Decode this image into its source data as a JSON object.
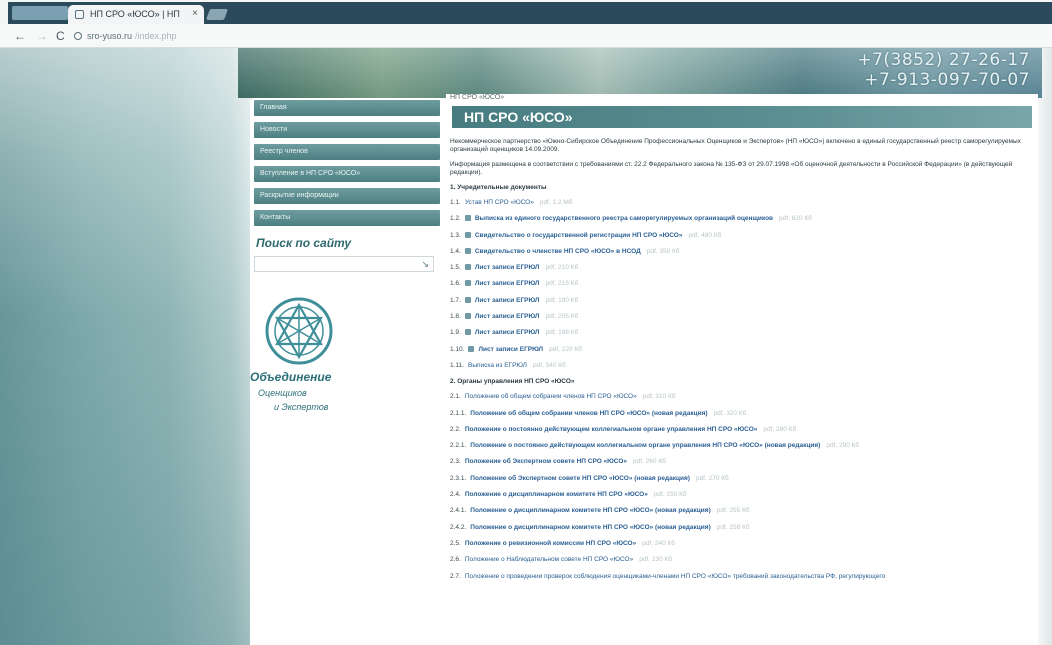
{
  "browser": {
    "tab_title": "НП СРО «ЮСО» | НП",
    "tab_close": "×",
    "url_domain": "sro-yuso.ru",
    "url_rest": "/index.php",
    "back": "←",
    "forward": "→",
    "reload": "C"
  },
  "header": {
    "phone1": "+7(3852) 27-26-17",
    "phone2": "+7-913-097-70-07"
  },
  "sidebar": {
    "menu": [
      "Главная",
      "Новости",
      "Реестр членов",
      "Вступление в НП СРО «ЮСО»",
      "Раскрытие информации",
      "Контакты"
    ],
    "search_title": "Поиск по сайту",
    "search_icon": "search-icon",
    "brand_name": "Объединение",
    "brand_line1": "Оценщиков",
    "brand_line2": "и Экспертов"
  },
  "main": {
    "breadcrumb": "НП СРО «ЮСО»",
    "title": "НП СРО «ЮСО»",
    "paragraphs": [
      "Некоммерческое партнерство «Южно-Сибирское Объединение Профессиональных Оценщиков и Экспертов» (НП «ЮСО») включено в единый государственный реестр саморегулируемых организаций оценщиков 14.09.2009.",
      "Информация размещена в соответствии с требованиями ст. 22.2 Федерального закона № 135-ФЗ от 29.07.1998 «Об оценочной деятельности в Российской Федерации» (в действующей редакции)."
    ],
    "section1_title": "1. Учредительные документы",
    "section1_docs": [
      {
        "num": "1.1.",
        "text": "Устав НП СРО «ЮСО»",
        "meta": "pdf, 1.2 Мб",
        "icon": false,
        "bold": false
      },
      {
        "num": "1.2.",
        "text": "Выписка из единого государственного реестра саморегулируемых организаций оценщиков",
        "meta": "pdf, 620 Кб",
        "icon": true,
        "bold": true
      },
      {
        "num": "1.3.",
        "text": "Свидетельство о государственной регистрации НП СРО «ЮСО»",
        "meta": "pdf, 480 Кб",
        "icon": true,
        "bold": true
      },
      {
        "num": "1.4.",
        "text": "Свидетельство о членстве НП СРО «ЮСО» в НСОД",
        "meta": "pdf, 350 Кб",
        "icon": true,
        "bold": true
      },
      {
        "num": "1.5.",
        "text": "Лист записи ЕГРЮЛ",
        "meta": "pdf, 210 Кб",
        "icon": true,
        "bold": true
      },
      {
        "num": "1.6.",
        "text": "Лист записи ЕГРЮЛ",
        "meta": "pdf, 215 Кб",
        "icon": true,
        "bold": true
      },
      {
        "num": "1.7.",
        "text": "Лист записи ЕГРЮЛ",
        "meta": "pdf, 190 Кб",
        "icon": true,
        "bold": true
      },
      {
        "num": "1.8.",
        "text": "Лист записи ЕГРЮЛ",
        "meta": "pdf, 205 Кб",
        "icon": true,
        "bold": true
      },
      {
        "num": "1.9.",
        "text": "Лист записи ЕГРЮЛ",
        "meta": "pdf, 198 Кб",
        "icon": true,
        "bold": true
      },
      {
        "num": "1.10.",
        "text": "Лист записи ЕГРЮЛ",
        "meta": "pdf, 220 Кб",
        "icon": true,
        "bold": true
      },
      {
        "num": "1.11.",
        "text": "Выписка из ЕГРЮЛ",
        "meta": "pdf, 540 Кб",
        "icon": false,
        "bold": false
      }
    ],
    "section2_title": "2. Органы управления НП СРО «ЮСО»",
    "section2_docs": [
      {
        "num": "2.1.",
        "text": "Положение об общем собрании членов НП СРО «ЮСО»",
        "meta": "pdf, 310 Кб",
        "bold": false
      },
      {
        "num": "2.1.1.",
        "text": "Положение об общем собрании членов НП СРО «ЮСО» (новая редакция)",
        "meta": "pdf, 320 Кб",
        "bold": true
      },
      {
        "num": "2.2.",
        "text": "Положение о постоянно действующем коллегиальном органе управления НП СРО «ЮСО»",
        "meta": "pdf, 280 Кб",
        "bold": true
      },
      {
        "num": "2.2.1.",
        "text": "Положение о постоянно действующем коллегиальном органе управления НП СРО «ЮСО» (новая редакция)",
        "meta": "pdf, 290 Кб",
        "bold": true
      },
      {
        "num": "2.3.",
        "text": "Положение об Экспертном совете НП СРО «ЮСО»",
        "meta": "pdf, 260 Кб",
        "bold": true
      },
      {
        "num": "2.3.1.",
        "text": "Положение об Экспертном совете НП СРО «ЮСО» (новая редакция)",
        "meta": "pdf, 270 Кб",
        "bold": true
      },
      {
        "num": "2.4.",
        "text": "Положение о дисциплинарном комитете НП СРО «ЮСО»",
        "meta": "pdf, 250 Кб",
        "bold": true
      },
      {
        "num": "2.4.1.",
        "text": "Положение о дисциплинарном комитете НП СРО «ЮСО» (новая редакция)",
        "meta": "pdf, 255 Кб",
        "bold": true
      },
      {
        "num": "2.4.2.",
        "text": "Положение о дисциплинарном комитете НП СРО «ЮСО» (новая редакция)",
        "meta": "pdf, 258 Кб",
        "bold": true
      },
      {
        "num": "2.5.",
        "text": "Положение о ревизионной комиссии НП СРО «ЮСО»",
        "meta": "pdf, 240 Кб",
        "bold": true
      },
      {
        "num": "2.6.",
        "text": "Положение о Наблюдательном совете НП СРО «ЮСО»",
        "meta": "pdf, 230 Кб",
        "bold": false
      },
      {
        "num": "2.7.",
        "text": "Положение о проведении проверок соблюдения оценщиками-членами НП СРО «ЮСО» требований законодательства РФ, регулирующего",
        "meta": "",
        "bold": false
      }
    ]
  }
}
